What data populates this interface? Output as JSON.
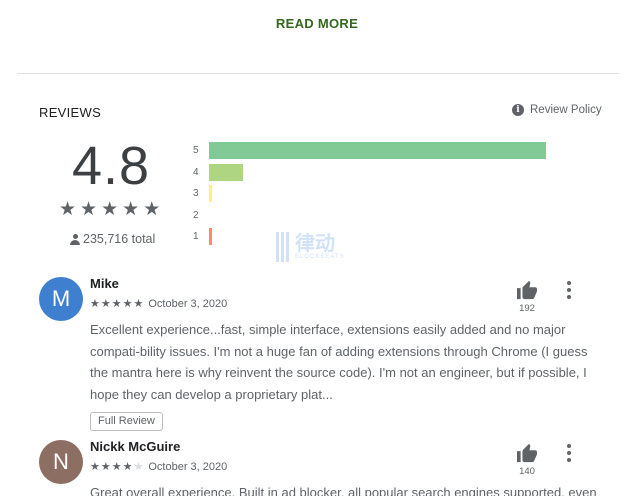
{
  "read_more": "READ MORE",
  "reviews": {
    "title": "REVIEWS",
    "policy_label": "Review Policy",
    "policy_icon": "info-icon",
    "rating": "4.8",
    "total": "235,716 total",
    "histogram": [
      {
        "label": "5",
        "fraction": 0.99,
        "color": "#81c995"
      },
      {
        "label": "4",
        "fraction": 0.1,
        "color": "#aed581"
      },
      {
        "label": "3",
        "fraction": 0.01,
        "color": "#fff176"
      },
      {
        "label": "2",
        "fraction": 0.0,
        "color": "#ffb74d"
      },
      {
        "label": "1",
        "fraction": 0.01,
        "color": "#ff8a65"
      }
    ]
  },
  "watermark": {
    "text": "律动",
    "sub": "BLOCKBEATS"
  },
  "review_list": [
    {
      "initial": "M",
      "avatar_color": "#3f7fcf",
      "name": "Mike",
      "rating": 5,
      "date": "October 3, 2020",
      "likes": "192",
      "text": "Excellent experience...fast, simple interface, extensions easily added and no major compati-bility issues. I'm not a huge fan of adding extensions through Chrome (I guess the mantra here is why reinvent the source code). I'm not an engineer, but if possible, I hope they can develop a proprietary plat...",
      "full_review_label": "Full Review"
    },
    {
      "initial": "N",
      "avatar_color": "#8d6e63",
      "name": "Nickk McGuire",
      "rating": 4,
      "date": "October 3, 2020",
      "likes": "140",
      "text": "Great overall experience. Built in ad blocker, all popular search engines supported, even duck"
    }
  ]
}
